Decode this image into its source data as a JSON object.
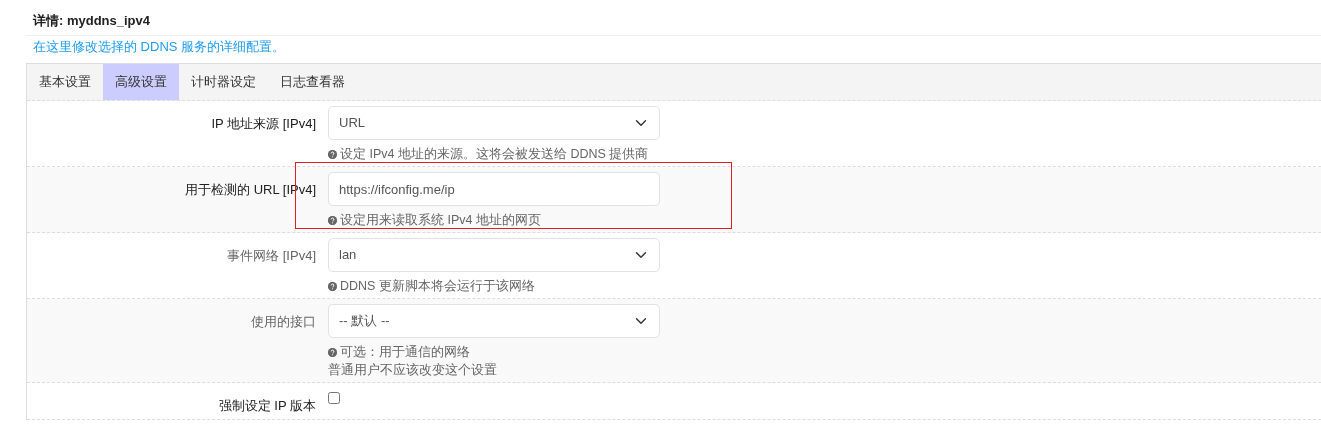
{
  "title": "详情: myddns_ipv4",
  "description": "在这里修改选择的 DDNS 服务的详细配置。",
  "tabs": [
    {
      "label": "基本设置",
      "selected": false
    },
    {
      "label": "高级设置",
      "selected": true
    },
    {
      "label": "计时器设定",
      "selected": false
    },
    {
      "label": "日志查看器",
      "selected": false
    }
  ],
  "rows": [
    {
      "kind": "select",
      "label": "IP 地址来源 [IPv4]",
      "label_muted": false,
      "value": "URL",
      "help": [
        "设定 IPv4 地址的来源。这将会被发送给 DDNS 提供商"
      ],
      "highlighted": false
    },
    {
      "kind": "text",
      "label": "用于检测的 URL [IPv4]",
      "label_muted": false,
      "value": "https://ifconfig.me/ip",
      "help": [
        "设定用来读取系统 IPv4 地址的网页"
      ],
      "highlighted": true
    },
    {
      "kind": "select",
      "label": "事件网络 [IPv4]",
      "label_muted": true,
      "value": "lan",
      "help": [
        "DDNS 更新脚本将会运行于该网络"
      ],
      "highlighted": false
    },
    {
      "kind": "select",
      "label": "使用的接口",
      "label_muted": true,
      "value": "-- 默认 --",
      "help": [
        "可选：用于通信的网络",
        "普通用户不应该改变这个设置"
      ],
      "highlighted": false
    },
    {
      "kind": "checkbox",
      "label": "强制设定 IP 版本",
      "label_muted": false,
      "checked": false,
      "highlighted": false
    }
  ]
}
